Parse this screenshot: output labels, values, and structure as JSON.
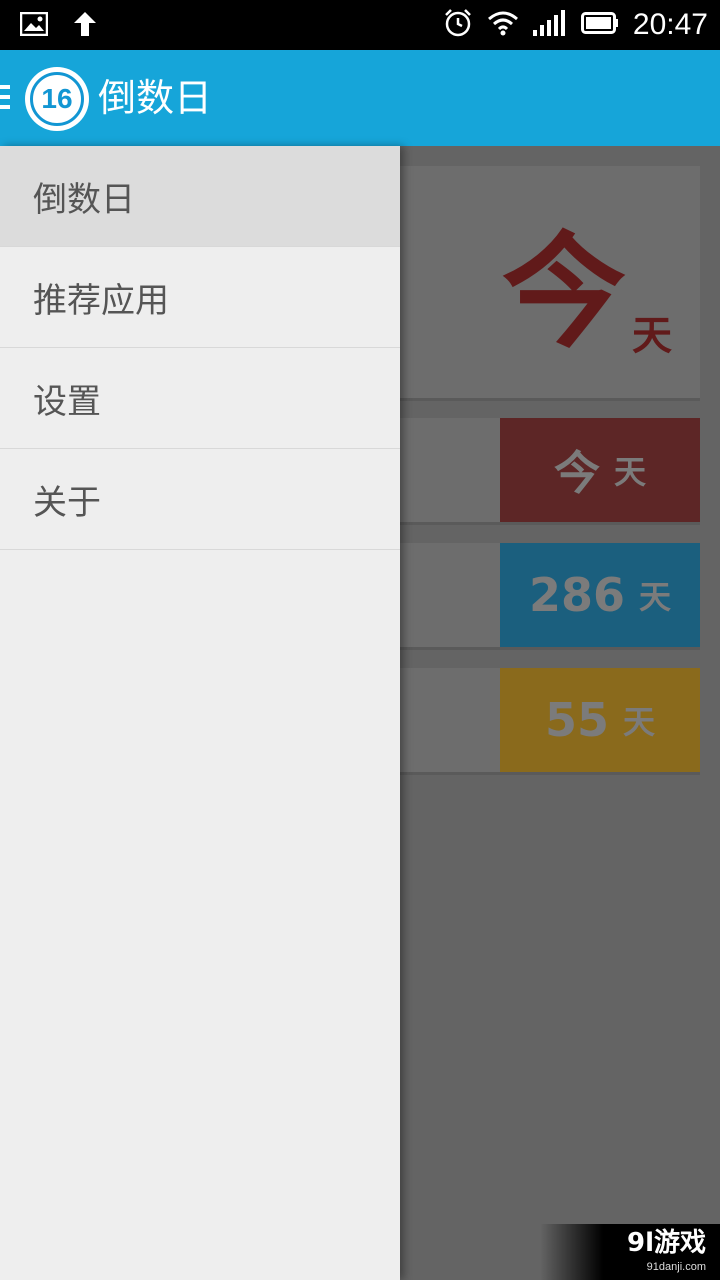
{
  "status_bar": {
    "time": "20:47",
    "icons": [
      "gallery-icon",
      "upload-arrow-icon",
      "alarm-icon",
      "wifi-icon",
      "signal-icon",
      "battery-icon"
    ]
  },
  "app_bar": {
    "logo_number": "16",
    "title": "倒数日",
    "color": "#16a5d9"
  },
  "drawer": {
    "items": [
      {
        "label": "倒数日",
        "selected": true
      },
      {
        "label": "推荐应用",
        "selected": false
      },
      {
        "label": "设置",
        "selected": false
      },
      {
        "label": "关于",
        "selected": false
      }
    ]
  },
  "content": {
    "hero": {
      "value": "今",
      "unit": "天",
      "color": "#611a1a"
    },
    "events": [
      {
        "value": "今",
        "unit": "天",
        "color": "#5d2626"
      },
      {
        "value": "286",
        "unit": "天",
        "color": "#1b5f7e"
      },
      {
        "value": "55",
        "unit": "天",
        "color": "#8a6a1c"
      }
    ]
  },
  "watermark": {
    "title": "9l游戏",
    "url": "91danji.com"
  }
}
